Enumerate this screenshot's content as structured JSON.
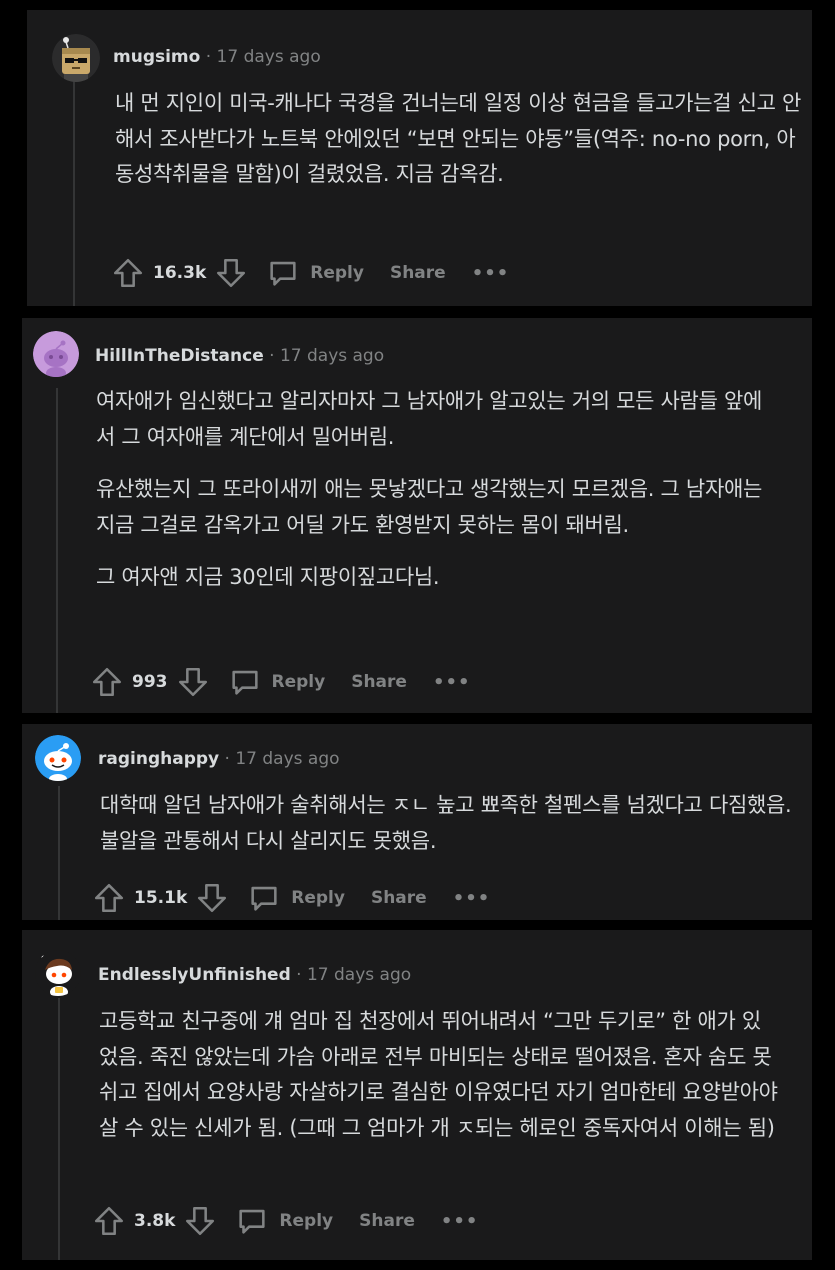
{
  "comments": [
    {
      "username": "mugsimo",
      "separator": "·",
      "time": "17 days ago",
      "avatar": "box-head-sunglasses-avatar",
      "paragraphs": [
        "내 먼 지인이 미국-캐나다 국경을 건너는데 일정 이상 현금을 들고가는걸 신고 안해서 조사받다가 노트북 안에있던 “보면 안되는 야동”들(역주: no-no porn, 아동성착취물을 말함)이 걸렸었음. 지금 감옥감."
      ],
      "score": "16.3k",
      "reply_label": "Reply",
      "share_label": "Share",
      "more_label": "•••"
    },
    {
      "username": "HillInTheDistance",
      "separator": "·",
      "time": "17 days ago",
      "avatar": "purple-snoo-avatar",
      "paragraphs": [
        "여자애가 임신했다고 알리자마자 그 남자애가 알고있는 거의 모든 사람들 앞에서 그 여자애를 계단에서 밀어버림.",
        "유산했는지 그 또라이새끼 애는 못낳겠다고 생각했는지 모르겠음. 그 남자애는 지금 그걸로 감옥가고 어딜 가도 환영받지 못하는 몸이 돼버림.",
        "그 여자앤 지금 30인데 지팡이짚고다님."
      ],
      "score": "993",
      "reply_label": "Reply",
      "share_label": "Share",
      "more_label": "•••"
    },
    {
      "username": "raginghappy",
      "separator": "·",
      "time": "17 days ago",
      "avatar": "blue-snoo-avatar",
      "paragraphs": [
        "대학때 알던 남자애가 술취해서는 ㅈㄴ 높고 뾰족한 철펜스를 넘겠다고 다짐했음. 불알을 관통해서 다시 살리지도 못했음."
      ],
      "score": "15.1k",
      "reply_label": "Reply",
      "share_label": "Share",
      "more_label": "•••"
    },
    {
      "username": "EndlesslyUnfinished",
      "separator": "·",
      "time": "17 days ago",
      "avatar": "snoo-brown-hair-avatar",
      "paragraphs": [
        "고등학교 친구중에 걔 엄마 집 천장에서 뛰어내려서 “그만 두기로” 한 애가 있었음. 죽진 않았는데 가슴 아래로 전부 마비되는 상태로 떨어졌음. 혼자 숨도 못쉬고 집에서 요양사랑 자살하기로 결심한 이유였다던 자기 엄마한테 요양받아야 살 수 있는 신세가 됨. (그때 그 엄마가 개 ㅈ되는 헤로인 중독자여서 이해는 됨)"
      ],
      "score": "3.8k",
      "reply_label": "Reply",
      "share_label": "Share",
      "more_label": "•••"
    }
  ],
  "colors": {
    "page_bg": "#000000",
    "card_bg": "#1a1a1b",
    "text": "#d7dadc",
    "meta": "#818384",
    "thread_line": "#343536"
  }
}
